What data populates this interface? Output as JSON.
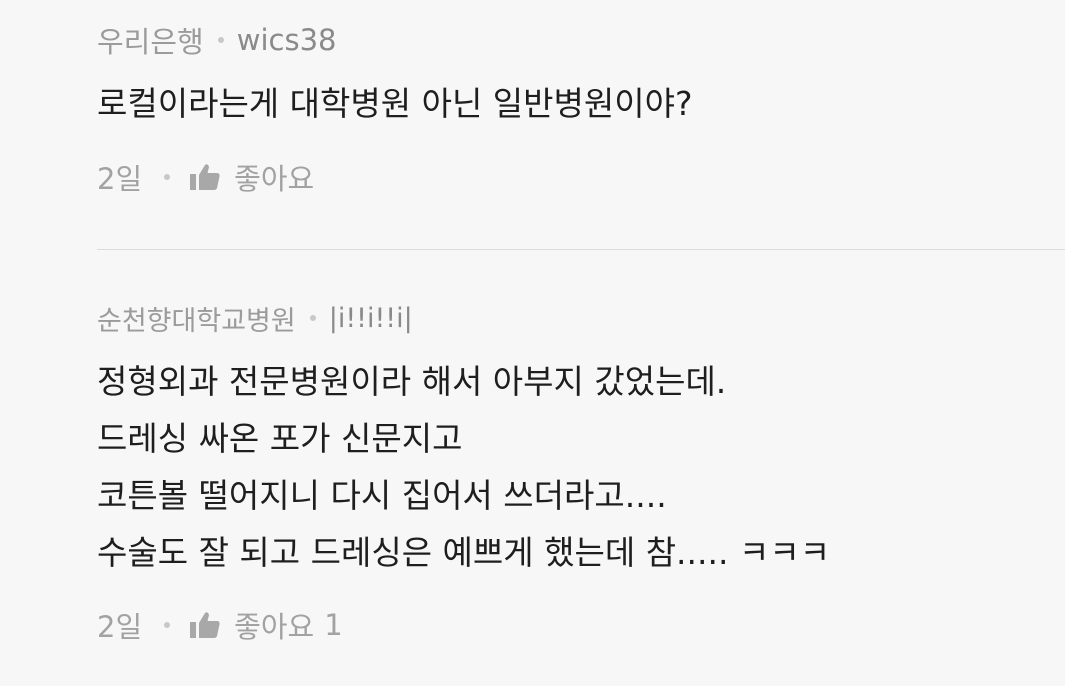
{
  "comments": [
    {
      "bank": "우리은행",
      "author": "wics38",
      "body": "로컬이라는게 대학병원 아닌 일반병원이야?",
      "age": "2일",
      "like_label": "좋아요",
      "like_count": ""
    },
    {
      "bank": "순천향대학교병원",
      "author": "|i!!i!!i|",
      "body": "정형외과 전문병원이라 해서 아부지 갔었는데.\n드레싱 싸온 포가 신문지고\n코튼볼 떨어지니 다시 집어서 쓰더라고....\n수술도 잘 되고 드레싱은 예쁘게 했는데 참..... ㅋㅋㅋ",
      "age": "2일",
      "like_label": "좋아요",
      "like_count": "1"
    }
  ],
  "icons": {
    "like": "thumbs-up-icon",
    "separator": "dot-separator"
  },
  "colors": {
    "background": "#f7f7f7",
    "meta_text": "#9b9b9b",
    "body_text": "#1e1e1e",
    "divider": "#dcdcdc"
  }
}
